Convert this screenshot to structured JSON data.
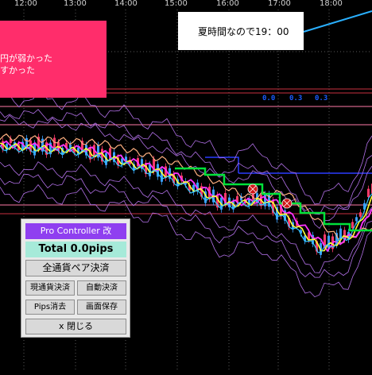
{
  "chart": {
    "time_labels": [
      "12:00",
      "13:00",
      "14:00",
      "15:00",
      "16:00",
      "17:00",
      "18:00"
    ],
    "value_boxes": [
      "0.0",
      "0.3",
      "0.3"
    ],
    "colors": {
      "background": "#000000",
      "candle_up": "#ff3b6b",
      "candle_down": "#3aa0ff",
      "ma_green": "#00e23a",
      "ma_yellow": "#ffff33",
      "ma_magenta": "#ff33ff",
      "ma_cyan": "#33c8ff",
      "ma_orange": "#ffb080",
      "band": "#b270e8",
      "hline_pink": "#ff7aa8",
      "hline_red": "#c83040",
      "hline_blue": "#2a3cff"
    }
  },
  "pink_note": {
    "line1": "円が弱かった",
    "line2": "すかった"
  },
  "callout": {
    "text": "夏時間なので19：00"
  },
  "panel": {
    "title": "Pro Controller 改",
    "total": "Total   0.0pips",
    "btn_all": "全通貨ペア決済",
    "btn_current": "現通貨決済",
    "btn_auto": "自動決済",
    "btn_pips": "Pips消去",
    "btn_save": "画面保存",
    "btn_close": "x 閉じる"
  }
}
